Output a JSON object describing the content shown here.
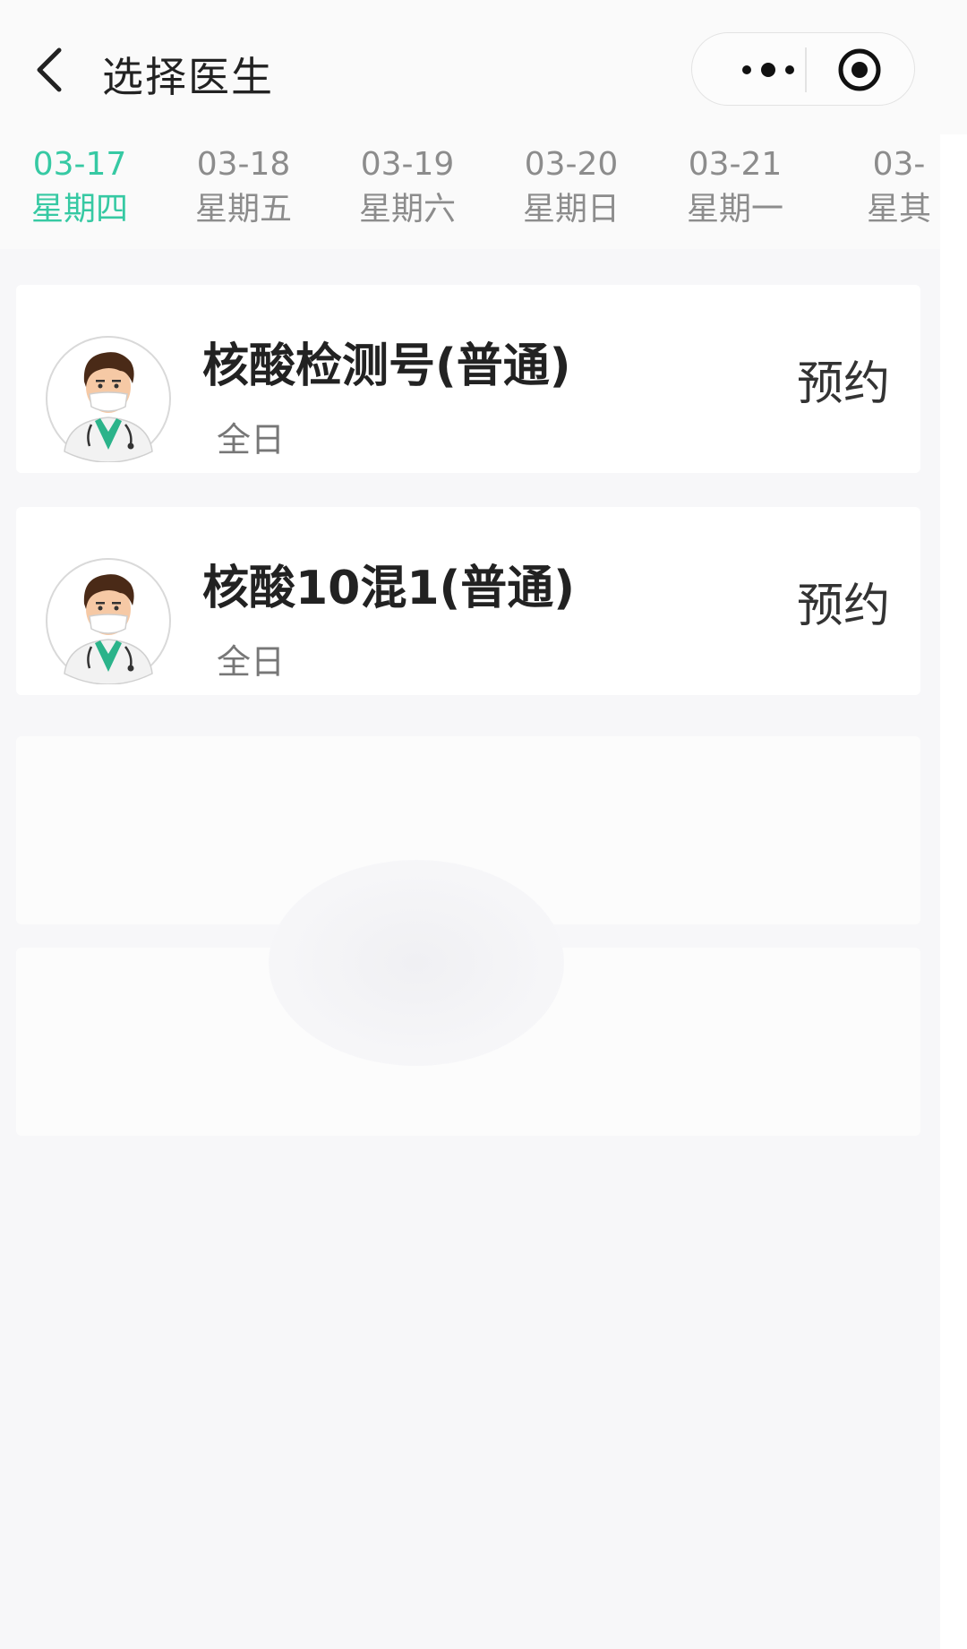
{
  "header": {
    "title": "选择医生",
    "back_icon": "chevron-left-icon",
    "more_icon": "more-dots-icon",
    "close_icon": "target-close-icon"
  },
  "dates": [
    {
      "date": "03-17",
      "weekday": "星期四",
      "active": true
    },
    {
      "date": "03-18",
      "weekday": "星期五",
      "active": false
    },
    {
      "date": "03-19",
      "weekday": "星期六",
      "active": false
    },
    {
      "date": "03-20",
      "weekday": "星期日",
      "active": false
    },
    {
      "date": "03-21",
      "weekday": "星期一",
      "active": false
    },
    {
      "date": "03-",
      "weekday": "星其",
      "active": false
    }
  ],
  "doctors": [
    {
      "name": "核酸检测号(普通)",
      "period": "全日",
      "action": "预约",
      "avatar": "doctor-avatar-icon"
    },
    {
      "name": "核酸10混1(普通)",
      "period": "全日",
      "action": "预约",
      "avatar": "doctor-avatar-icon"
    }
  ],
  "colors": {
    "accent": "#36c9a3",
    "background": "#f7f7f9",
    "card": "#ffffff"
  }
}
